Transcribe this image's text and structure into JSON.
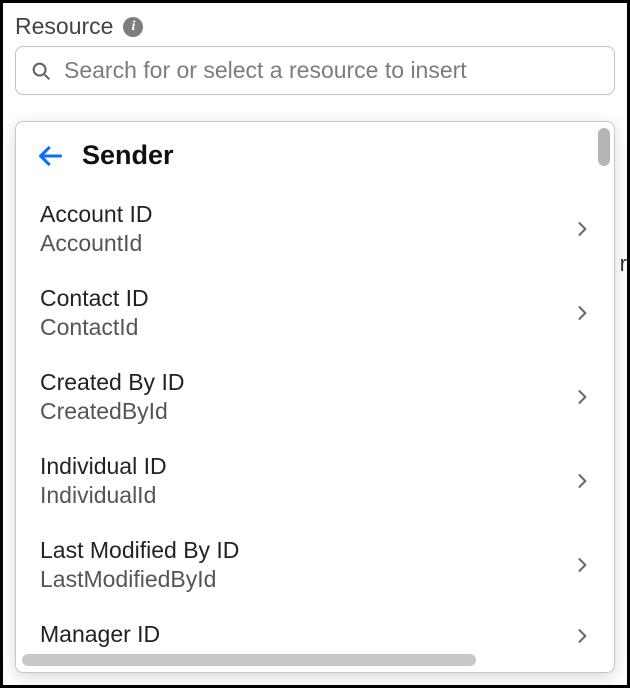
{
  "field": {
    "label": "Resource",
    "info_icon": "i"
  },
  "search": {
    "placeholder": "Search for or select a resource to insert",
    "value": ""
  },
  "dropdown": {
    "title": "Sender",
    "options": [
      {
        "label": "Account ID",
        "api": "AccountId"
      },
      {
        "label": "Contact ID",
        "api": "ContactId"
      },
      {
        "label": "Created By ID",
        "api": "CreatedById"
      },
      {
        "label": "Individual ID",
        "api": "IndividualId"
      },
      {
        "label": "Last Modified By ID",
        "api": "LastModifiedById"
      },
      {
        "label": "Manager ID",
        "api": ""
      }
    ]
  },
  "background": {
    "right_fragment": "r"
  }
}
